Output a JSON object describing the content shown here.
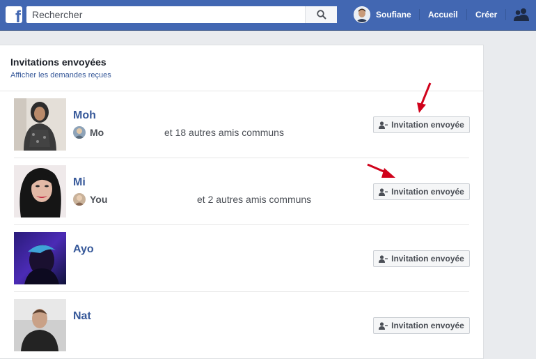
{
  "colors": {
    "brand": "#4267b2",
    "link": "#365899",
    "arrow": "#d0021b"
  },
  "topbar": {
    "logo": "f",
    "search_placeholder": "Rechercher",
    "search_icon": "search-icon",
    "user_name": "Soufiane",
    "home_label": "Accueil",
    "create_label": "Créer",
    "friends_icon": "friend-requests-icon"
  },
  "panel": {
    "title": "Invitations envoyées",
    "subtitle_link": "Afficher les demandes reçues"
  },
  "requests": [
    {
      "name": "Moh",
      "mutual_first": "Mo",
      "mutual_rest": "et 18 autres amis communs",
      "button_label": "Invitation envoyée"
    },
    {
      "name": "Mi",
      "mutual_first": "You",
      "mutual_rest": "et 2 autres amis communs",
      "button_label": "Invitation envoyée"
    },
    {
      "name": "Ayo",
      "button_label": "Invitation envoyée"
    },
    {
      "name": "Nat",
      "button_label": "Invitation envoyée"
    }
  ]
}
